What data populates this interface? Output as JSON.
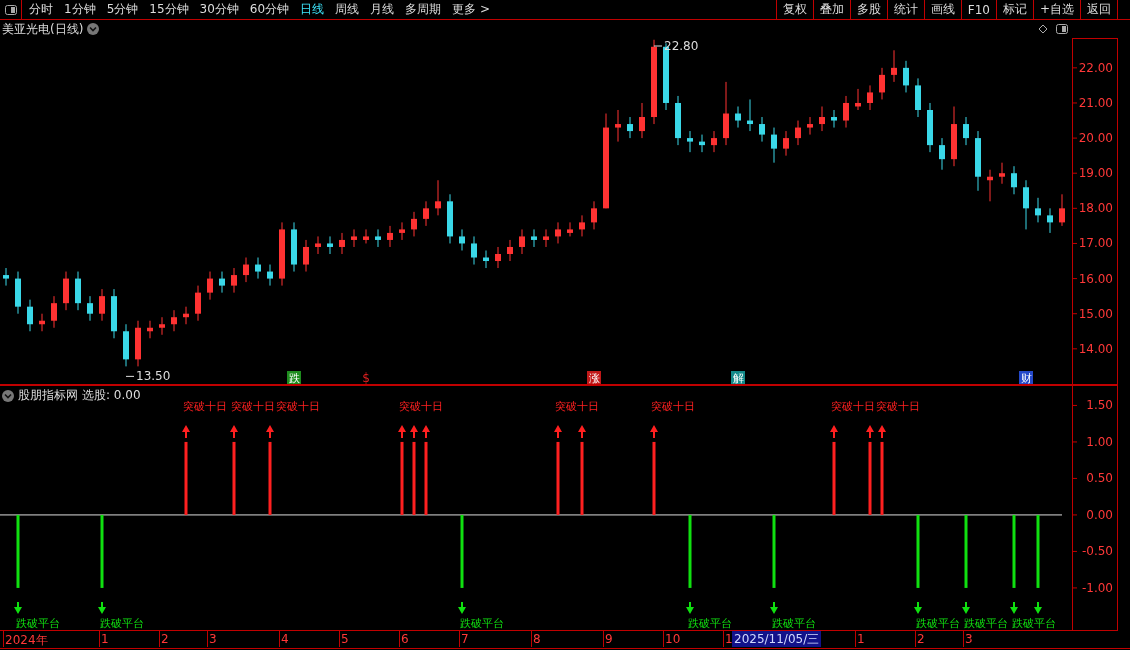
{
  "toolbar": {
    "periods": [
      {
        "label": "分时",
        "selected": false
      },
      {
        "label": "1分钟",
        "selected": false
      },
      {
        "label": "5分钟",
        "selected": false
      },
      {
        "label": "15分钟",
        "selected": false
      },
      {
        "label": "30分钟",
        "selected": false
      },
      {
        "label": "60分钟",
        "selected": false
      },
      {
        "label": "日线",
        "selected": true
      },
      {
        "label": "周线",
        "selected": false
      },
      {
        "label": "月线",
        "selected": false
      },
      {
        "label": "多周期",
        "selected": false
      },
      {
        "label": "更多 >",
        "selected": false
      }
    ],
    "buttons": [
      "复权",
      "叠加",
      "多股",
      "统计",
      "画线",
      "F10",
      "标记",
      "+自选",
      "返回"
    ]
  },
  "title": "美亚光电(日线)",
  "price_chart": {
    "chart_data": {
      "type": "candlestick",
      "ylim": [
        12.97,
        22.85
      ],
      "yticks": [
        {
          "value": 14,
          "label": "14.00"
        },
        {
          "value": 15,
          "label": "15.00"
        },
        {
          "value": 16,
          "label": "16.00"
        },
        {
          "value": 17,
          "label": "17.00"
        },
        {
          "value": 18,
          "label": "18.00"
        },
        {
          "value": 19,
          "label": "19.00"
        },
        {
          "value": 20,
          "label": "20.00"
        },
        {
          "value": 21,
          "label": "21.00"
        },
        {
          "value": 22,
          "label": "22.00"
        }
      ],
      "categories": [
        null,
        null,
        null,
        null,
        null,
        null,
        null,
        null,
        null,
        null,
        null,
        null,
        null,
        null,
        null,
        null,
        null,
        null,
        null,
        null,
        null,
        null,
        null,
        null,
        null,
        null,
        null,
        null,
        null,
        null,
        null,
        null,
        null,
        null,
        null,
        null,
        null,
        null,
        null,
        null,
        null,
        null,
        null,
        null,
        null,
        null,
        null,
        null,
        null,
        null,
        null,
        null,
        null,
        null,
        null,
        null,
        null,
        null,
        null,
        null,
        null,
        null,
        null,
        null,
        null,
        null,
        null,
        null,
        null,
        null,
        null,
        null,
        null,
        null,
        null,
        null,
        null,
        null,
        null,
        null,
        null,
        null,
        null,
        null,
        null,
        null,
        null,
        null,
        null
      ],
      "ohlc": [
        [
          16.1,
          16.3,
          15.8,
          16.0
        ],
        [
          16.0,
          16.2,
          15.0,
          15.2
        ],
        [
          15.2,
          15.4,
          14.5,
          14.7
        ],
        [
          14.7,
          15.0,
          14.5,
          14.8
        ],
        [
          14.8,
          15.5,
          14.6,
          15.3
        ],
        [
          15.3,
          16.2,
          15.1,
          16.0
        ],
        [
          16.0,
          16.2,
          15.1,
          15.3
        ],
        [
          15.3,
          15.5,
          14.8,
          15.0
        ],
        [
          15.0,
          15.7,
          14.8,
          15.5
        ],
        [
          15.5,
          15.7,
          14.3,
          14.5
        ],
        [
          14.5,
          14.7,
          13.5,
          13.7
        ],
        [
          13.7,
          14.8,
          13.5,
          14.6
        ],
        [
          14.5,
          14.8,
          14.3,
          14.6
        ],
        [
          14.6,
          14.9,
          14.4,
          14.7
        ],
        [
          14.7,
          15.1,
          14.5,
          14.9
        ],
        [
          14.9,
          15.2,
          14.7,
          15.0
        ],
        [
          15.0,
          15.8,
          14.8,
          15.6
        ],
        [
          15.6,
          16.2,
          15.4,
          16.0
        ],
        [
          16.0,
          16.2,
          15.6,
          15.8
        ],
        [
          15.8,
          16.3,
          15.6,
          16.1
        ],
        [
          16.1,
          16.6,
          15.9,
          16.4
        ],
        [
          16.4,
          16.6,
          16.0,
          16.2
        ],
        [
          16.2,
          16.4,
          15.8,
          16.0
        ],
        [
          16.0,
          17.6,
          15.8,
          17.4
        ],
        [
          17.4,
          17.6,
          16.2,
          16.4
        ],
        [
          16.4,
          17.1,
          16.2,
          16.9
        ],
        [
          16.9,
          17.2,
          16.7,
          17.0
        ],
        [
          17.0,
          17.2,
          16.7,
          16.9
        ],
        [
          16.9,
          17.3,
          16.7,
          17.1
        ],
        [
          17.1,
          17.4,
          16.9,
          17.2
        ],
        [
          17.1,
          17.4,
          17.0,
          17.2
        ],
        [
          17.2,
          17.4,
          16.9,
          17.1
        ],
        [
          17.1,
          17.5,
          16.9,
          17.3
        ],
        [
          17.3,
          17.6,
          17.1,
          17.4
        ],
        [
          17.4,
          17.9,
          17.2,
          17.7
        ],
        [
          17.7,
          18.2,
          17.5,
          18.0
        ],
        [
          18.0,
          18.8,
          17.8,
          18.2
        ],
        [
          18.2,
          18.4,
          17.0,
          17.2
        ],
        [
          17.2,
          17.4,
          16.8,
          17.0
        ],
        [
          17.0,
          17.2,
          16.4,
          16.6
        ],
        [
          16.6,
          16.8,
          16.3,
          16.5
        ],
        [
          16.5,
          16.9,
          16.3,
          16.7
        ],
        [
          16.7,
          17.1,
          16.5,
          16.9
        ],
        [
          16.9,
          17.4,
          16.7,
          17.2
        ],
        [
          17.2,
          17.4,
          16.9,
          17.1
        ],
        [
          17.1,
          17.4,
          16.9,
          17.2
        ],
        [
          17.2,
          17.6,
          17.0,
          17.4
        ],
        [
          17.3,
          17.6,
          17.2,
          17.4
        ],
        [
          17.4,
          17.8,
          17.2,
          17.6
        ],
        [
          17.6,
          18.2,
          17.4,
          18.0
        ],
        [
          18.0,
          20.7,
          18.0,
          20.3
        ],
        [
          20.3,
          20.8,
          19.9,
          20.4
        ],
        [
          20.4,
          20.6,
          20.0,
          20.2
        ],
        [
          20.2,
          21.0,
          20.0,
          20.6
        ],
        [
          20.6,
          22.8,
          20.4,
          22.6
        ],
        [
          22.6,
          22.7,
          20.8,
          21.0
        ],
        [
          21.0,
          21.2,
          19.8,
          20.0
        ],
        [
          20.0,
          20.2,
          19.6,
          19.9
        ],
        [
          19.9,
          20.1,
          19.6,
          19.8
        ],
        [
          19.8,
          20.2,
          19.6,
          20.0
        ],
        [
          20.0,
          21.6,
          19.8,
          20.7
        ],
        [
          20.7,
          20.9,
          20.3,
          20.5
        ],
        [
          20.5,
          21.1,
          20.2,
          20.4
        ],
        [
          20.4,
          20.6,
          19.9,
          20.1
        ],
        [
          20.1,
          20.3,
          19.3,
          19.7
        ],
        [
          19.7,
          20.2,
          19.5,
          20.0
        ],
        [
          20.0,
          20.5,
          19.8,
          20.3
        ],
        [
          20.3,
          20.6,
          20.1,
          20.4
        ],
        [
          20.4,
          20.9,
          20.2,
          20.6
        ],
        [
          20.6,
          20.8,
          20.3,
          20.5
        ],
        [
          20.5,
          21.2,
          20.3,
          21.0
        ],
        [
          20.9,
          21.4,
          20.8,
          21.0
        ],
        [
          21.0,
          21.5,
          20.8,
          21.3
        ],
        [
          21.3,
          22.0,
          21.1,
          21.8
        ],
        [
          21.8,
          22.5,
          21.6,
          22.0
        ],
        [
          22.0,
          22.2,
          21.3,
          21.5
        ],
        [
          21.5,
          21.7,
          20.6,
          20.8
        ],
        [
          20.8,
          21.0,
          19.6,
          19.8
        ],
        [
          19.8,
          20.0,
          19.1,
          19.4
        ],
        [
          19.4,
          20.9,
          19.2,
          20.4
        ],
        [
          20.4,
          20.6,
          19.8,
          20.0
        ],
        [
          20.0,
          20.2,
          18.5,
          18.9
        ],
        [
          18.8,
          19.1,
          18.2,
          18.9
        ],
        [
          18.9,
          19.3,
          18.7,
          19.0
        ],
        [
          19.0,
          19.2,
          18.4,
          18.6
        ],
        [
          18.6,
          18.8,
          17.4,
          18.0
        ],
        [
          18.0,
          18.3,
          17.6,
          17.8
        ],
        [
          17.8,
          18.0,
          17.3,
          17.6
        ],
        [
          17.6,
          18.4,
          17.5,
          18.0
        ]
      ],
      "annotations": [
        "22.80",
        "13.50"
      ]
    },
    "events": [
      {
        "kind": "box",
        "text": "跌",
        "color": "#1e8c1e"
      },
      {
        "kind": "plain",
        "text": "$",
        "color": "#e02020"
      },
      {
        "kind": "box",
        "text": "涨",
        "color": "#c01818"
      },
      {
        "kind": "box",
        "text": "解",
        "color": "#138a8a"
      },
      {
        "kind": "box",
        "text": "财",
        "color": "#2448c8"
      }
    ]
  },
  "indicator": {
    "name": "股朋指标网",
    "reading": "选股: 0.00",
    "chart_data": {
      "type": "bar",
      "stacked": true,
      "ylim": [
        -1.59,
        1.78
      ],
      "yticks": [
        {
          "value": 1.5,
          "label": "1.50"
        },
        {
          "value": 1,
          "label": "1.00"
        },
        {
          "value": 0.5,
          "label": "0.50"
        },
        {
          "value": 0,
          "label": "0.00"
        },
        {
          "value": -0.5,
          "label": "-0.50"
        },
        {
          "value": -1,
          "label": "-1.00"
        }
      ],
      "categories": [
        null,
        null,
        null,
        null,
        null,
        null,
        null,
        null,
        null,
        null,
        null,
        null,
        null,
        null,
        null,
        null,
        null,
        null,
        null,
        null,
        null,
        null,
        null,
        null,
        null,
        null,
        null,
        null,
        null,
        null,
        null,
        null,
        null,
        null,
        null,
        null,
        null,
        null,
        null,
        null,
        null,
        null,
        null,
        null,
        null,
        null,
        null,
        null,
        null,
        null,
        null,
        null,
        null,
        null,
        null,
        null,
        null,
        null,
        null,
        null,
        null,
        null,
        null,
        null,
        null,
        null,
        null,
        null,
        null,
        null,
        null,
        null,
        null,
        null,
        null,
        null,
        null,
        null,
        null,
        null,
        null,
        null,
        null,
        null,
        null,
        null,
        null,
        null,
        null
      ],
      "series": [
        {
          "color": "#ff2020",
          "values": [
            0,
            0,
            0,
            0,
            0,
            0,
            0,
            0,
            0,
            0,
            0,
            0,
            0,
            0,
            0,
            1,
            0,
            0,
            0,
            1,
            0,
            0,
            1,
            0,
            0,
            0,
            0,
            0,
            0,
            0,
            0,
            0,
            0,
            1,
            1,
            1,
            0,
            0,
            0,
            0,
            0,
            0,
            0,
            0,
            0,
            0,
            1,
            0,
            1,
            0,
            0,
            0,
            0,
            0,
            1,
            0,
            0,
            0,
            0,
            0,
            0,
            0,
            0,
            0,
            0,
            0,
            0,
            0,
            0,
            1,
            0,
            0,
            1,
            1,
            0,
            0,
            0,
            0,
            0,
            0,
            0,
            0,
            0,
            0,
            0,
            0,
            0,
            0,
            0
          ]
        },
        {
          "color": "#10e010",
          "values": [
            0,
            -1,
            0,
            0,
            0,
            0,
            0,
            0,
            -1,
            0,
            0,
            0,
            0,
            0,
            0,
            0,
            0,
            0,
            0,
            0,
            0,
            0,
            0,
            0,
            0,
            0,
            0,
            0,
            0,
            0,
            0,
            0,
            0,
            0,
            0,
            0,
            0,
            0,
            -1,
            0,
            0,
            0,
            0,
            0,
            0,
            0,
            0,
            0,
            0,
            0,
            0,
            0,
            0,
            0,
            0,
            0,
            0,
            -1,
            0,
            0,
            0,
            0,
            0,
            0,
            -1,
            0,
            0,
            0,
            0,
            0,
            0,
            0,
            0,
            0,
            0,
            0,
            -1,
            0,
            0,
            0,
            -1,
            0,
            0,
            0,
            -1,
            0,
            -1,
            0,
            0
          ]
        }
      ]
    },
    "signal_labels": {
      "up": [
        "突破十日",
        "突破十日",
        "突破十日",
        "突破十日",
        "突破十日",
        "突破十日",
        "突破十日",
        "突破十日"
      ],
      "down": [
        "跌破平台",
        "跌破平台",
        "跌破平台",
        "跌破平台",
        "跌破平台",
        "跌破平台",
        "跌破平台",
        "跌破平台"
      ]
    }
  },
  "time_axis": {
    "labels": [
      "2024年",
      "1",
      "2",
      "3",
      "4",
      "5",
      "6",
      "7",
      "8",
      "9",
      "10",
      "1",
      "1",
      "2",
      "3"
    ],
    "cursor_date": "2025/11/05/三"
  }
}
